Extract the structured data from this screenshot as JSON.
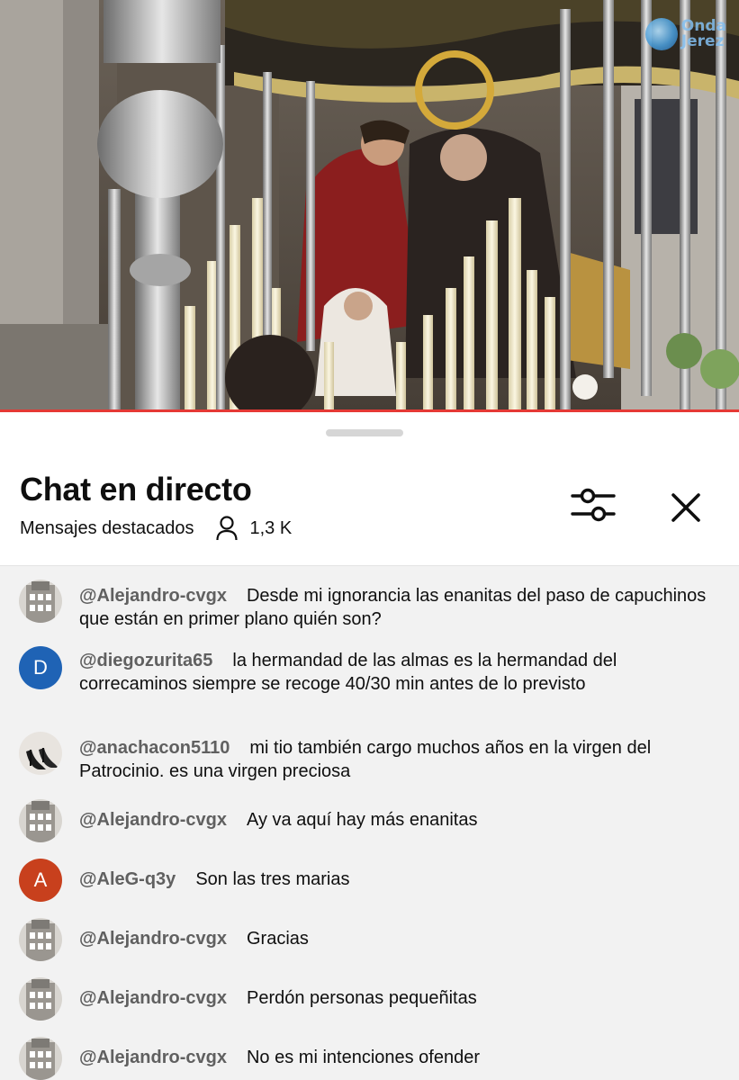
{
  "watermark": {
    "line1": "Onda",
    "line2": "Jerez"
  },
  "video": {
    "progress_fraction": 1.0,
    "progress_color": "#e53935"
  },
  "chat": {
    "title": "Chat en directo",
    "mode": "Mensajes destacados",
    "viewers": "1,3 K",
    "filter_icon": "sliders-icon",
    "close_icon": "close-icon",
    "messages": [
      {
        "author": "@Alejandro-cvgx",
        "text": "Desde mi ignorancia las enanitas del paso de capuchinos que están en primer plano quién son?",
        "avatar": "building-photo"
      },
      {
        "author": "@diegozurita65",
        "text": "la hermandad de las almas es la hermandad del correcaminos siempre se recoge 40/30 min antes de lo previsto",
        "avatar": "letter",
        "letter": "D",
        "color": "#1f63b5"
      },
      {
        "author": "@anachacon5110",
        "text": "mi tio también cargo muchos años en la virgen del Patrocinio. es una virgen preciosa",
        "avatar": "shoes-photo"
      },
      {
        "author": "@Alejandro-cvgx",
        "text": "Ay va aquí hay más enanitas",
        "avatar": "building-photo"
      },
      {
        "author": "@AleG-q3y",
        "text": "Son las tres marias",
        "avatar": "letter",
        "letter": "A",
        "color": "#c8401d"
      },
      {
        "author": "@Alejandro-cvgx",
        "text": "Gracias",
        "avatar": "building-photo"
      },
      {
        "author": "@Alejandro-cvgx",
        "text": "Perdón personas pequeñitas",
        "avatar": "building-photo"
      },
      {
        "author": "@Alejandro-cvgx",
        "text": "No es mi intenciones ofender",
        "avatar": "building-photo"
      }
    ]
  }
}
